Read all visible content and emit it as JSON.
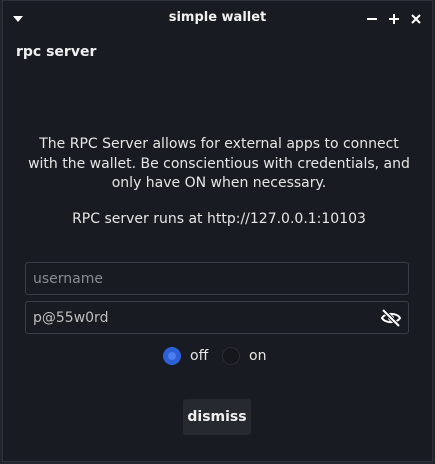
{
  "window": {
    "title": "simple wallet",
    "menu_icon": "triangle-down-icon",
    "minimize_label": "−",
    "maximize_label": "+",
    "close_label": "✕"
  },
  "section": {
    "title": "rpc server"
  },
  "content": {
    "description": "The RPC Server allows for external apps to connect with the wallet. Be conscientious with credentials, and only have ON when necessary.",
    "server_address": "RPC server runs at http://127.0.0.1:10103"
  },
  "form": {
    "username": {
      "value": "",
      "placeholder": "username"
    },
    "password": {
      "value": "p@55w0rd",
      "placeholder": "",
      "visibility_icon": "eye-off-icon"
    },
    "server_toggle": {
      "options": [
        "off",
        "on"
      ],
      "selected": "off"
    }
  },
  "actions": {
    "dismiss_label": "dismiss"
  },
  "colors": {
    "window_bg": "#181b21",
    "outer_bg": "#22242b",
    "accent": "#2f5fd6",
    "text": "#e6e6e6"
  }
}
